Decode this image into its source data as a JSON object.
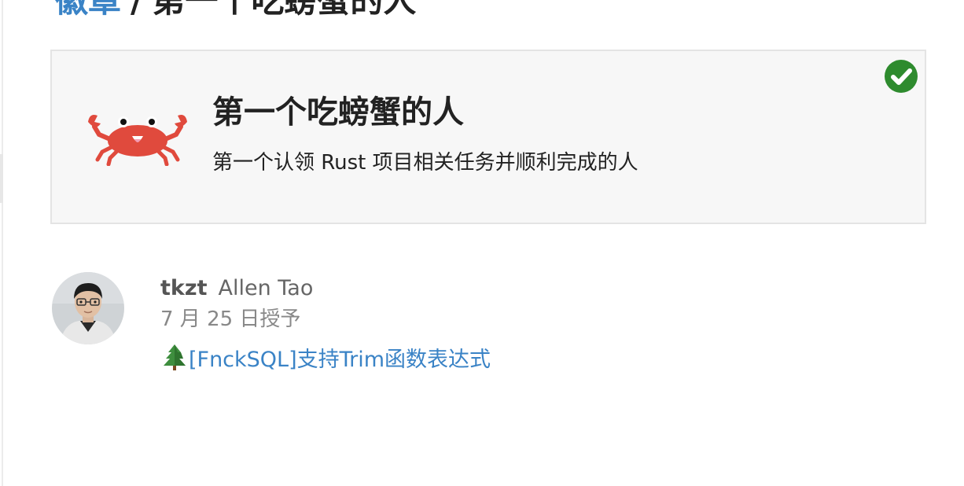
{
  "breadcrumb": {
    "parent_label": "徽章",
    "separator": "/",
    "current_label": "第一个吃螃蟹的人"
  },
  "badge": {
    "icon": "crab-icon",
    "title": "第一个吃螃蟹的人",
    "description": "第一个认领 Rust 项目相关任务并顺利完成的人",
    "status_icon": "checkmark-circle-icon",
    "colors": {
      "crab": "#e04a3d",
      "check": "#2e8b2e",
      "card_bg": "#f7f7f7",
      "card_border": "#e4e4e4"
    }
  },
  "grant": {
    "username": "tkzt",
    "full_name": "Allen Tao",
    "granted_date": "7 月 25 日授予",
    "topic_icon": "evergreen-tree-icon",
    "topic_title": "[FnckSQL]支持Trim函数表达式",
    "link_color": "#3a83c6"
  }
}
